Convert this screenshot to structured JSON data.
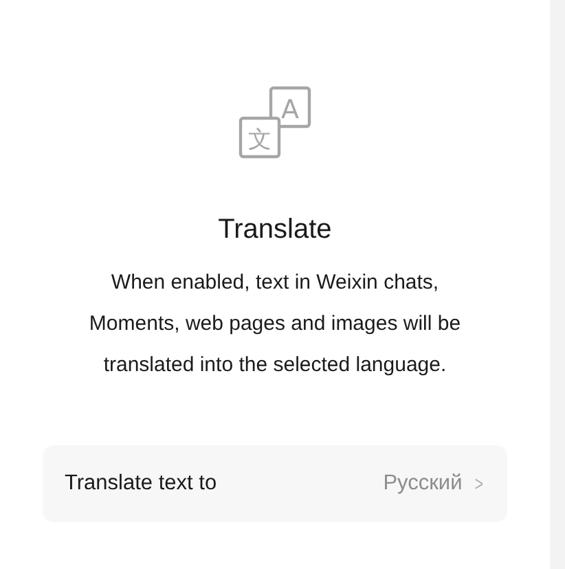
{
  "icon_glyphs": [
    "文",
    "A"
  ],
  "title": "Translate",
  "description": "When enabled, text in Weixin chats, Moments, web pages and images will be translated into the selected language.",
  "setting": {
    "label": "Translate text to",
    "value": "Русский",
    "chevron": ">"
  }
}
